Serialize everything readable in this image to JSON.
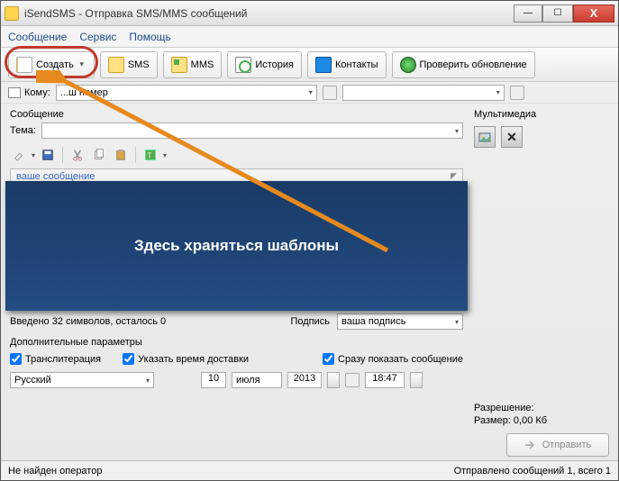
{
  "title": "iSendSMS - Отправка SMS/MMS сообщений",
  "menu": {
    "msg": "Сообщение",
    "service": "Сервис",
    "help": "Помощь"
  },
  "toolbar": {
    "create": "Создать",
    "sms": "SMS",
    "mms": "MMS",
    "history": "История",
    "contacts": "Контакты",
    "check": "Проверить обновление"
  },
  "to": {
    "label": "Кому:",
    "value": "...ш номер"
  },
  "message": {
    "section": "Сообщение",
    "tema_label": "Тема:",
    "placeholder": "ваше сообщение"
  },
  "tooltip": "Здесь храняться шаблоны",
  "counter": "Введено 32 символов, осталось 0",
  "signature": {
    "label": "Подпись",
    "value": "ваша подпись"
  },
  "params": {
    "label": "Дополнительные параметры",
    "translit": "Транслитерация",
    "delivery": "Указать время доставки",
    "show": "Сразу показать сообщение",
    "lang": "Русский",
    "day": "10",
    "month": "июля",
    "year": "2013",
    "time": "18:47"
  },
  "multimedia": {
    "label": "Мультимедиа",
    "resolution": "Разрешение:",
    "size": "Размер: 0,00 Кб"
  },
  "send": "Отправить",
  "status": {
    "left": "Не найден оператор",
    "right": "Отправлено сообщений 1, всего 1"
  }
}
